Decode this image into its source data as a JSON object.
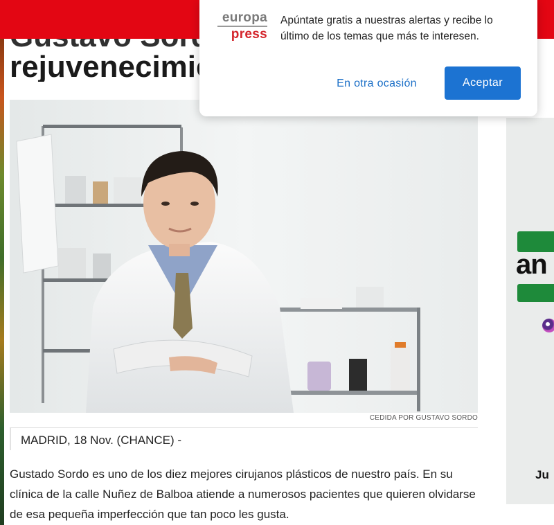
{
  "colors": {
    "brand_red": "#e30613",
    "accept_button": "#1c73d2",
    "link_blue": "#1b6fc7"
  },
  "article": {
    "headline_line1": "Gustavo Sordo:",
    "headline_line2": "rejuvenecimiento",
    "photo_credit": "CEDIDA POR GUSTAVO SORDO",
    "dateline": "MADRID, 18 Nov. (CHANCE) -",
    "body": "Gustado Sordo es uno de los diez mejores cirujanos plásticos de nuestro país. En su clínica de la calle Nuñez de Balboa atiende a numerosos pacientes que quieren olvidarse de esa pequeña imperfección que tan poco les gusta."
  },
  "sidebar_ad": {
    "text_fragment": "an",
    "bottom_text": "Ju",
    "brand_color": "#1e8a3a"
  },
  "popup": {
    "logo_top": "europa",
    "logo_bottom": "press",
    "message": "Apúntate gratis a nuestras alertas y recibe lo último de los temas que más te interesen.",
    "decline_label": "En otra ocasión",
    "accept_label": "Aceptar"
  }
}
